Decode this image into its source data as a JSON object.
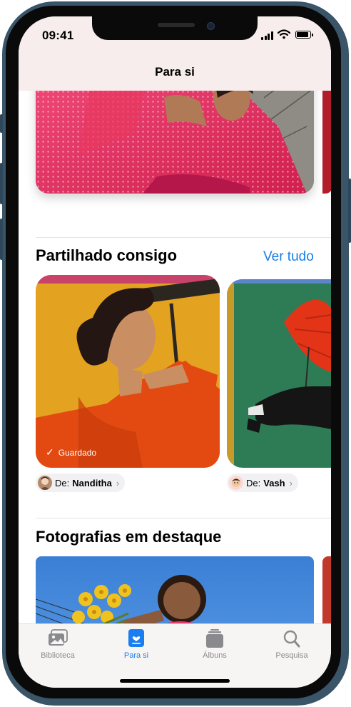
{
  "status_bar": {
    "time": "09:41"
  },
  "nav": {
    "title": "Para si"
  },
  "sections": {
    "shared": {
      "title": "Partilhado consigo",
      "see_all": "Ver tudo",
      "items": [
        {
          "saved_label": "Guardado",
          "from_label": "De:",
          "sender": "Nanditha"
        },
        {
          "from_label": "De:",
          "sender": "Vash"
        }
      ]
    },
    "featured": {
      "title": "Fotografias em destaque"
    }
  },
  "tabs": [
    {
      "label": "Biblioteca",
      "icon": "photo-library-icon",
      "active": false
    },
    {
      "label": "Para si",
      "icon": "for-you-icon",
      "active": true
    },
    {
      "label": "Álbuns",
      "icon": "albums-icon",
      "active": false
    },
    {
      "label": "Pesquisa",
      "icon": "search-icon",
      "active": false
    }
  ],
  "colors": {
    "accent": "#147eea",
    "device_frame": "#3a5468"
  }
}
